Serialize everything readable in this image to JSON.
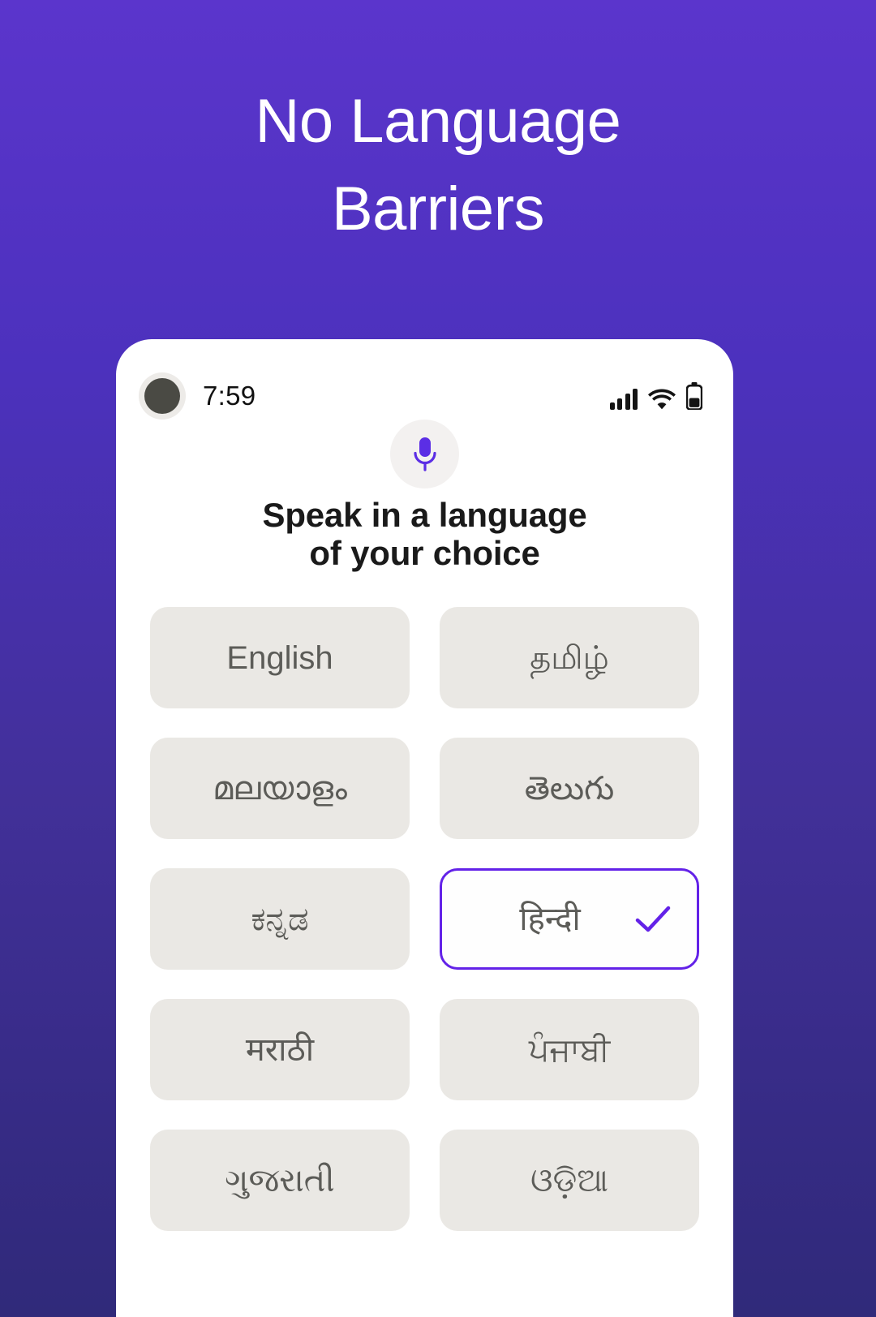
{
  "headline": "No Language\nBarriers",
  "colors": {
    "bg_top": "#5B35CC",
    "bg_bottom": "#302A7A",
    "accent": "#6322E8",
    "mic_purple": "#5B2EE5",
    "button_bg": "#EAE8E4",
    "button_text": "#5C5C58"
  },
  "phone": {
    "status_bar": {
      "time": "7:59",
      "avatar_name": "profile-avatar",
      "signal_icon": "signal-bars-icon",
      "wifi_icon": "wifi-icon",
      "battery_icon": "battery-icon"
    },
    "mic_icon": "microphone-icon",
    "heading": "Speak in a language\nof your choice",
    "languages": [
      {
        "label": "English",
        "name": "english",
        "selected": false
      },
      {
        "label": "தமிழ்",
        "name": "tamil",
        "selected": false
      },
      {
        "label": "മലയാളം",
        "name": "malayalam",
        "selected": false
      },
      {
        "label": "తెలుగు",
        "name": "telugu",
        "selected": false
      },
      {
        "label": "ಕನ್ನಡ",
        "name": "kannada",
        "selected": false
      },
      {
        "label": "हिन्दी",
        "name": "hindi",
        "selected": true
      },
      {
        "label": "मराठी",
        "name": "marathi",
        "selected": false
      },
      {
        "label": "ਪੰਜਾਬੀ",
        "name": "punjabi",
        "selected": false
      },
      {
        "label": "ગુજરાતી",
        "name": "gujarati",
        "selected": false
      },
      {
        "label": "ଓଡ଼ିଆ",
        "name": "odia",
        "selected": false
      }
    ],
    "check_icon": "check-icon"
  }
}
